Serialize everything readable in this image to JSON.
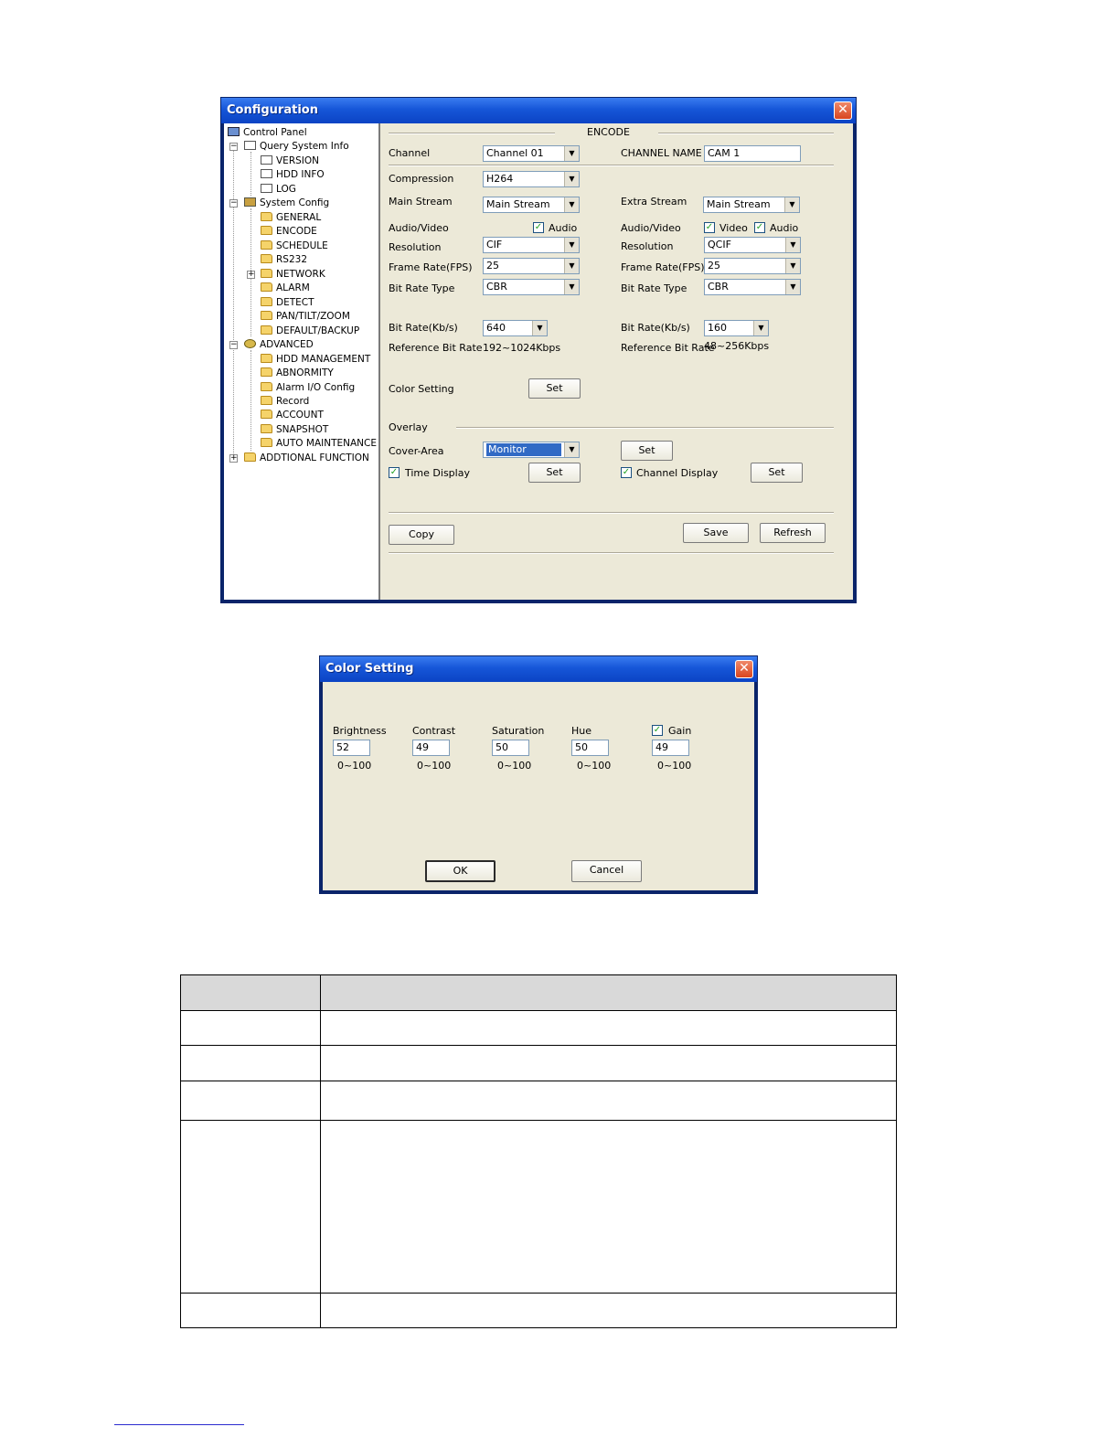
{
  "config_window": {
    "title": "Configuration",
    "close_glyph": "✕",
    "tree": [
      {
        "label": "Control Panel",
        "icon": "computer-icon"
      },
      {
        "label": "Query System Info",
        "icon": "document-edit-icon",
        "expander": "−"
      },
      {
        "label": "VERSION",
        "icon": "document-edit-icon"
      },
      {
        "label": "HDD INFO",
        "icon": "document-edit-icon"
      },
      {
        "label": "LOG",
        "icon": "document-edit-icon"
      },
      {
        "label": "System Config",
        "icon": "tools-icon",
        "expander": "−"
      },
      {
        "label": "GENERAL",
        "icon": "folder-icon"
      },
      {
        "label": "ENCODE",
        "icon": "folder-icon"
      },
      {
        "label": "SCHEDULE",
        "icon": "folder-icon"
      },
      {
        "label": "RS232",
        "icon": "folder-icon"
      },
      {
        "label": "NETWORK",
        "icon": "folder-icon",
        "expander": "+"
      },
      {
        "label": "ALARM",
        "icon": "folder-icon"
      },
      {
        "label": "DETECT",
        "icon": "folder-icon"
      },
      {
        "label": "PAN/TILT/ZOOM",
        "icon": "folder-icon"
      },
      {
        "label": "DEFAULT/BACKUP",
        "icon": "folder-icon"
      },
      {
        "label": "ADVANCED",
        "icon": "gears-icon",
        "expander": "−"
      },
      {
        "label": "HDD MANAGEMENT",
        "icon": "folder-icon"
      },
      {
        "label": "ABNORMITY",
        "icon": "folder-icon"
      },
      {
        "label": "Alarm I/O Config",
        "icon": "folder-icon"
      },
      {
        "label": "Record",
        "icon": "folder-icon"
      },
      {
        "label": "ACCOUNT",
        "icon": "folder-icon"
      },
      {
        "label": "SNAPSHOT",
        "icon": "folder-icon"
      },
      {
        "label": "AUTO MAINTENANCE",
        "icon": "folder-icon"
      },
      {
        "label": "ADDTIONAL FUNCTION",
        "icon": "folder-icon",
        "expander": "+"
      }
    ],
    "encode": {
      "section_title": "ENCODE",
      "channel_label": "Channel",
      "channel_value": "Channel 01",
      "channel_name_label": "CHANNEL NAME",
      "channel_name_value": "CAM 1",
      "compression_label": "Compression",
      "compression_value": "H264",
      "main_stream_label": "Main Stream",
      "main_stream_value": "Main Stream",
      "extra_stream_label": "Extra Stream",
      "extra_stream_value": "Main Stream",
      "audio_video_label": "Audio/Video",
      "audio_label": "Audio",
      "video_label": "Video",
      "resolution_label": "Resolution",
      "main_resolution": "CIF",
      "extra_resolution": "QCIF",
      "frame_rate_label": "Frame Rate(FPS)",
      "main_frame_rate": "25",
      "extra_frame_rate": "25",
      "bit_rate_type_label": "Bit Rate Type",
      "main_bit_rate_type": "CBR",
      "extra_bit_rate_type": "CBR",
      "bit_rate_label": "Bit Rate(Kb/s)",
      "main_bit_rate": "640",
      "extra_bit_rate": "160",
      "reference_bit_rate_label": "Reference Bit Rate",
      "main_reference_bit_rate": "192~1024Kbps",
      "extra_reference_bit_rate": "48~256Kbps",
      "color_setting_label": "Color Setting",
      "set_label": "Set",
      "overlay_label": "Overlay",
      "cover_area_label": "Cover-Area",
      "cover_area_value": "Monitor",
      "time_display_label": "Time Display",
      "channel_display_label": "Channel Display",
      "copy_label": "Copy",
      "save_label": "Save",
      "refresh_label": "Refresh",
      "check_glyph": "✓",
      "arrow_glyph": "▼"
    }
  },
  "color_window": {
    "title": "Color Setting",
    "close_glyph": "✕",
    "fields": [
      {
        "label": "Brightness",
        "value": "52",
        "range": "0~100"
      },
      {
        "label": "Contrast",
        "value": "49",
        "range": "0~100"
      },
      {
        "label": "Saturation",
        "value": "50",
        "range": "0~100"
      },
      {
        "label": "Hue",
        "value": "50",
        "range": "0~100"
      },
      {
        "label": "Gain",
        "value": "49",
        "range": "0~100"
      }
    ],
    "ok_label": "OK",
    "cancel_label": "Cancel"
  }
}
